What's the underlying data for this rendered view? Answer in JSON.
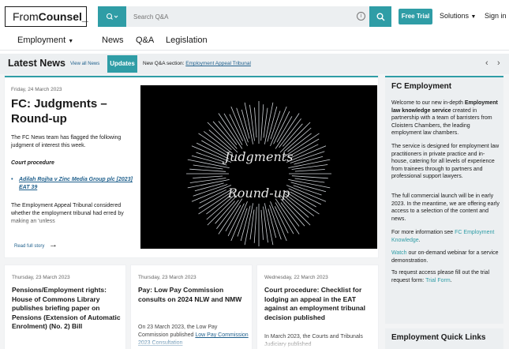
{
  "header": {
    "logo_left": "From",
    "logo_right": "Counsel_",
    "search_placeholder": "Search Q&A",
    "free_trial": "Free Trial",
    "solutions": "Solutions",
    "sign_in": "Sign in"
  },
  "nav": {
    "employment": "Employment",
    "news": "News",
    "qa": "Q&A",
    "legislation": "Legislation"
  },
  "news_bar": {
    "title": "Latest News",
    "view_all": "View all News",
    "updates": "Updates",
    "ticker_prefix": "New Q&A section: ",
    "ticker_link": "Employment Appeal Tribunal"
  },
  "feature": {
    "date": "Friday, 24 March 2023",
    "title": "FC: Judgments – Round-up",
    "intro": "The FC News team has flagged the following judgment of interest this week.",
    "subheading": "Court procedure",
    "bullet": "Adilah Rojha v Zinc Media Group plc [2023] EAT 39",
    "body": "The Employment Appeal Tribunal considered whether the employment tribunal had erred by making an 'unless",
    "read_full": "Read full story",
    "image_text_1": "Judgments",
    "image_text_2": "Round-up"
  },
  "cards": [
    {
      "date": "Thursday, 23 March 2023",
      "title": "Pensions/Employment rights: House of Commons Library publishes briefing paper on Pensions (Extension of Automatic Enrolment) (No. 2) Bill",
      "text": ""
    },
    {
      "date": "Thursday, 23 March 2023",
      "title": "Pay: Low Pay Commission consults on 2024 NLW and NMW",
      "text_prefix": "On 23 March 2023, the Low Pay Commission published ",
      "text_link": "Low Pay Commission 2023 Consultation"
    },
    {
      "date": "Wednesday, 22 March 2023",
      "title": "Court procedure: Checklist for lodging an appeal in the EAT against an employment tribunal decision published",
      "text": "In March 2023, the Courts and Tribunals Judiciary published"
    }
  ],
  "sidebar": {
    "title": "FC Employment",
    "p1_prefix": "Welcome to our new in-depth ",
    "p1_bold": "Employment law knowledge service",
    "p1_suffix": " created in partnership with a team of barristers from Cloisters Chambers, the leading employment law chambers.",
    "p2": "The service is designed for employment law practitioners in private practice and in-house, catering for all levels of experience from trainees through to partners and professional support lawyers.",
    "p3": "The full commercial launch will be in early 2023. In the meantime, we are offering early access to a selection of the content and news.",
    "p4_prefix": "For more information see ",
    "p4_link": "FC Employment Knowledge",
    "p4_suffix": ".",
    "p5_link": "Watch",
    "p5_suffix": " our on-demand webinar for a service demonstration.",
    "p6_prefix": "To request access please fill out the trial request form: ",
    "p6_link": "Trial Form",
    "p6_suffix": ".",
    "quick_links_title": "Employment Quick Links"
  },
  "colors": {
    "accent": "#2f9da6",
    "link": "#1e5f8c",
    "panel": "#eceff1"
  }
}
